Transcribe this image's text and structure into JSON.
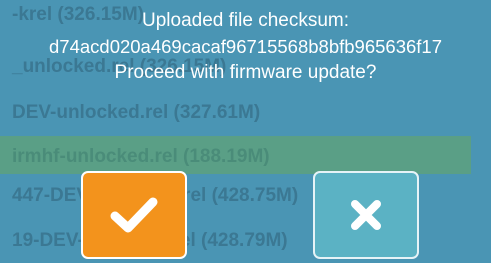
{
  "background_list": {
    "items": [
      "-krel (326.15M)",
      "_unlocked.rel (326.15M)",
      "DEV-unlocked.rel (327.61M)",
      "irmhf-unlocked.rel (188.19M)",
      "447-DEV-unlocked.rel (428.75M)",
      "19-DEV-unlocked.rel (428.79M)"
    ],
    "highlight_color": "#5a9f86"
  },
  "dialog": {
    "line1": "Uploaded file checksum:",
    "checksum": "d74acd020a469cacaf96715568b8bfb965636f17",
    "question": "Proceed with firmware update?",
    "confirm_icon": "checkmark-icon",
    "cancel_icon": "x-icon",
    "confirm_color": "#f3931c",
    "cancel_color": "#5bb2c4"
  }
}
